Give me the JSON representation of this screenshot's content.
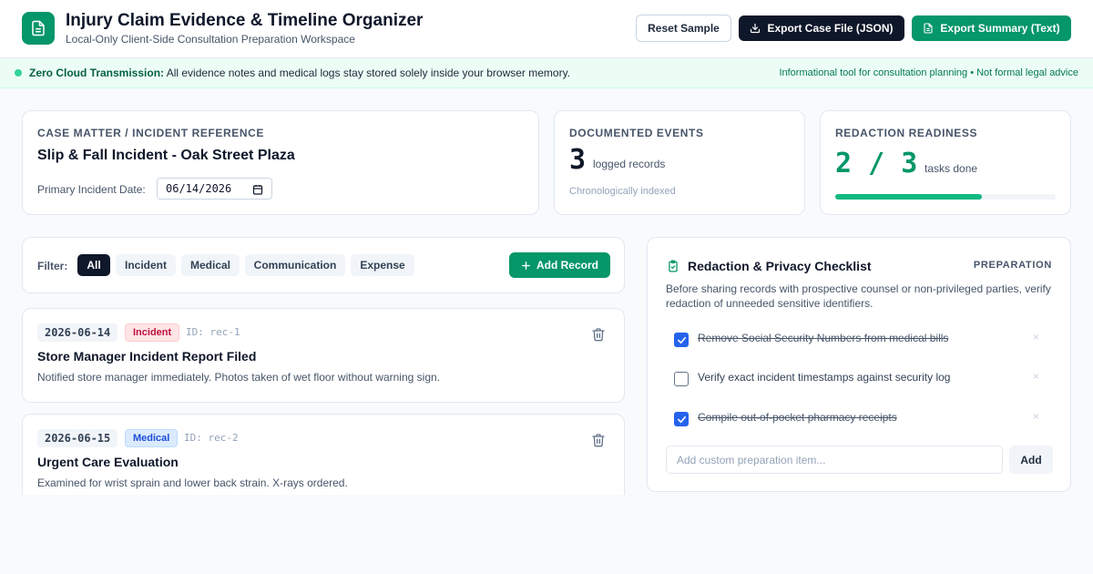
{
  "header": {
    "title": "Injury Claim Evidence & Timeline Organizer",
    "subtitle": "Local-Only Client-Side Consultation Preparation Workspace",
    "reset_label": "Reset Sample",
    "export_json_label": "Export Case File (JSON)",
    "export_text_label": "Export Summary (Text)"
  },
  "banner": {
    "strong": "Zero Cloud Transmission:",
    "text": "All evidence notes and medical logs stay stored solely inside your browser memory.",
    "right": "Informational tool for consultation planning • Not formal legal advice"
  },
  "case": {
    "label": "CASE MATTER / INCIDENT REFERENCE",
    "title": "Slip & Fall Incident - Oak Street Plaza",
    "date_label": "Primary Incident Date:",
    "date_value": "06/14/2026"
  },
  "events": {
    "label": "DOCUMENTED EVENTS",
    "count": "3",
    "sub": "logged records",
    "note": "Chronologically indexed"
  },
  "readiness": {
    "label": "REDACTION READINESS",
    "value": "2 / 3",
    "sub": "tasks done",
    "fraction": 0.667
  },
  "filter": {
    "label": "Filter:",
    "chips": [
      "All",
      "Incident",
      "Medical",
      "Communication",
      "Expense"
    ],
    "active": "All",
    "add_label": "Add Record"
  },
  "records": [
    {
      "date": "2026-06-14",
      "tag": "Incident",
      "id": "ID: rec-1",
      "title": "Store Manager Incident Report Filed",
      "desc": "Notified store manager immediately. Photos taken of wet floor without warning sign."
    },
    {
      "date": "2026-06-15",
      "tag": "Medical",
      "id": "ID: rec-2",
      "title": "Urgent Care Evaluation",
      "desc": "Examined for wrist sprain and lower back strain. X-rays ordered."
    }
  ],
  "checklist": {
    "title": "Redaction & Privacy Checklist",
    "badge": "PREPARATION",
    "desc": "Before sharing records with prospective counsel or non-privileged parties, verify redaction of unneeded sensitive identifiers.",
    "items": [
      {
        "text": "Remove Social Security Numbers from medical bills",
        "checked": true
      },
      {
        "text": "Verify exact incident timestamps against security log",
        "checked": false
      },
      {
        "text": "Compile out-of-pocket pharmacy receipts",
        "checked": true
      }
    ],
    "remove_glyph": "×",
    "input_placeholder": "Add custom preparation item...",
    "add_label": "Add"
  },
  "colors": {
    "brand": "#059669",
    "dark": "#0f172a",
    "checkbox": "#2563eb",
    "incident_tag": "#be123c",
    "medical_tag": "#1d4ed8"
  }
}
